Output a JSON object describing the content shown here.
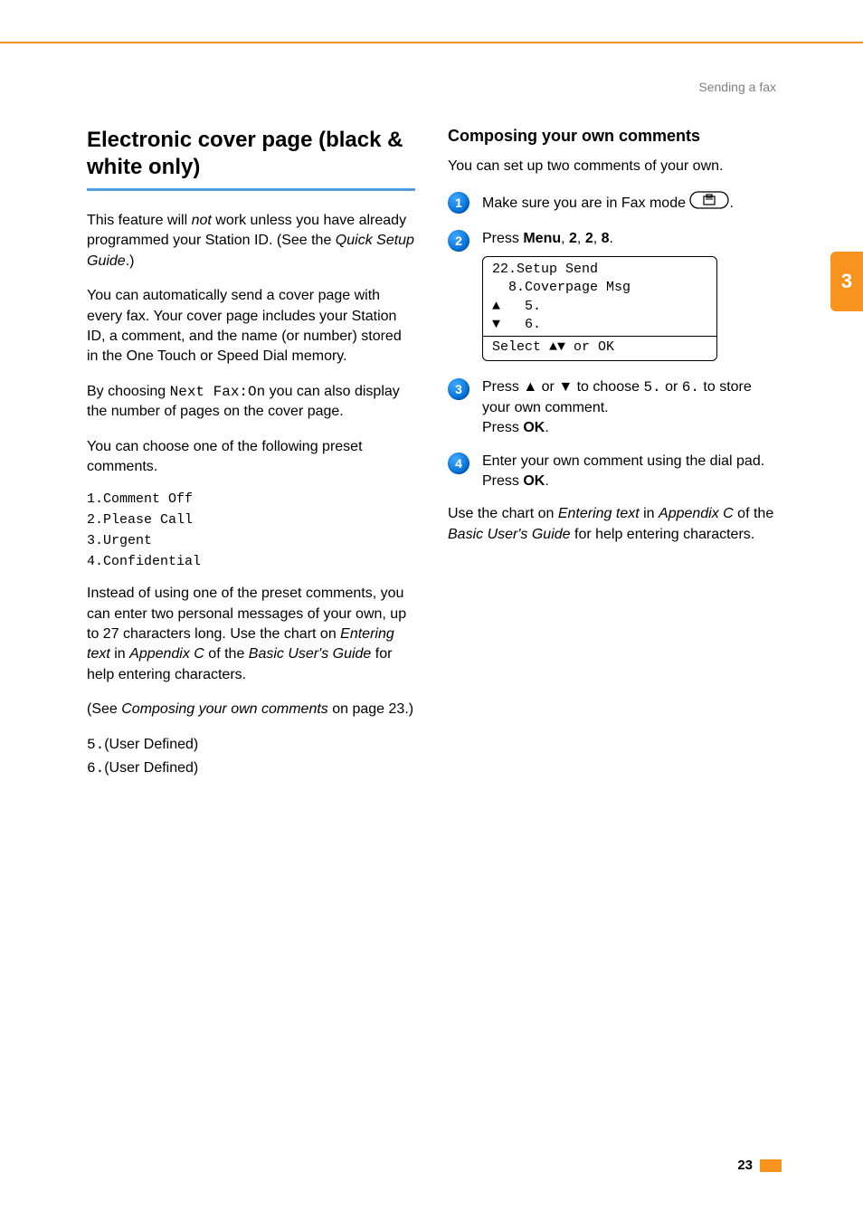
{
  "header": {
    "crumb": "Sending a fax"
  },
  "side_tab": "3",
  "page_number": "23",
  "left": {
    "title": "Electronic cover page (black & white only)",
    "p1_a": "This feature will ",
    "p1_not": "not",
    "p1_b": " work unless you have already programmed your Station ID. (See the ",
    "p1_guide": "Quick Setup Guide",
    "p1_c": ".)",
    "p2": "You can automatically send a cover page with every fax. Your cover page includes your Station ID, a comment, and the name (or number) stored in the One Touch or Speed Dial memory.",
    "p3_a": "By choosing ",
    "p3_code": "Next Fax:On",
    "p3_b": " you can also display the number of pages on the cover page.",
    "p4": "You can choose one of the following preset comments.",
    "presets": [
      "1.Comment Off",
      "2.Please Call",
      "3.Urgent",
      "4.Confidential"
    ],
    "p5_a": "Instead of using one of the preset comments, you can enter two personal messages of your own, up to 27 characters long. Use the chart on ",
    "p5_link1": "Entering text",
    "p5_b": " in ",
    "p5_link2": "Appendix C",
    "p5_c": " of the ",
    "p5_link3": "Basic User's Guide",
    "p5_d": " for help entering characters.",
    "p6_a": "(See ",
    "p6_link": "Composing your own comments",
    "p6_b": " on page 23.)",
    "user_defined": [
      {
        "code": "5.",
        "label": "(User Defined)"
      },
      {
        "code": "6.",
        "label": "(User Defined)"
      }
    ]
  },
  "right": {
    "heading": "Composing your own comments",
    "intro": "You can set up two comments of your own.",
    "step1": {
      "num": "1",
      "a": "Make sure you are in Fax mode ",
      "b": "."
    },
    "step2": {
      "num": "2",
      "a": "Press ",
      "menu": "Menu",
      "comma": ", ",
      "k1": "2",
      "k2": "2",
      "k3": "8",
      "end": ".",
      "lcd": {
        "l1": "22.Setup Send",
        "l2": "  8.Coverpage Msg",
        "l3": "▲   5.",
        "l4": "▼   6.",
        "l5": "Select ▲▼ or OK"
      }
    },
    "step3": {
      "num": "3",
      "a": "Press ",
      "up": "▲",
      "or1": " or ",
      "down": "▼",
      "b": " to choose ",
      "c5": "5.",
      "or2": " or ",
      "c6": "6.",
      "c": " to store your own comment.",
      "press": "Press ",
      "ok": "OK",
      "dot": "."
    },
    "step4": {
      "num": "4",
      "a": "Enter your own comment using the dial pad.",
      "press": "Press ",
      "ok": "OK",
      "dot": "."
    },
    "footer_a": "Use the chart on ",
    "footer_link1": "Entering text",
    "footer_b": " in ",
    "footer_link2": "Appendix C",
    "footer_c": " of the ",
    "footer_link3": "Basic User's Guide",
    "footer_d": " for help entering characters."
  }
}
